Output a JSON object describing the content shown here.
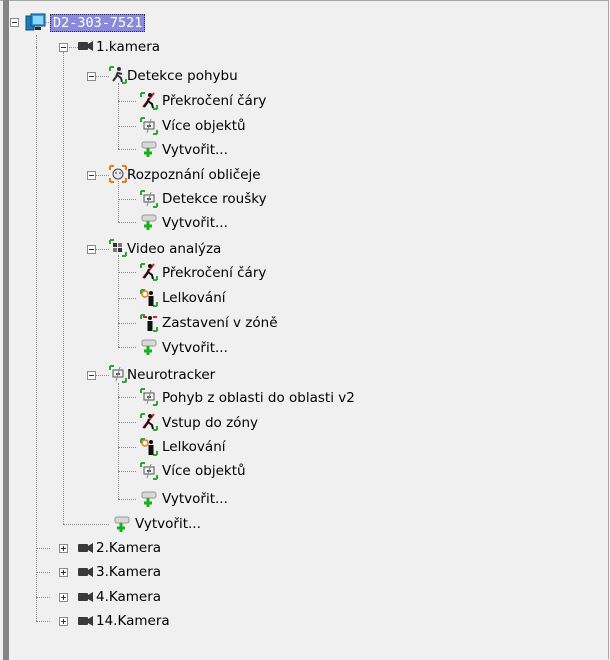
{
  "tree": {
    "server": "D2-303-7521",
    "camera1": {
      "label": "1.kamera",
      "detekce_pohybu": {
        "label": "Detekce pohybu",
        "children": [
          "Překročení čáry",
          "Více objektů",
          "Vytvořit..."
        ]
      },
      "rozpoznani": {
        "label": "Rozpoznání obličeje",
        "children": [
          "Detekce roušky",
          "Vytvořit..."
        ]
      },
      "video_analyza": {
        "label": "Video analýza",
        "children": [
          "Překročení čáry",
          "Lelkování",
          "Zastavení v zóně",
          "Vytvořit..."
        ]
      },
      "neurotracker": {
        "label": "Neurotracker",
        "children": [
          "Pohyb z oblasti do oblasti v2",
          "Vstup do zóny",
          "Lelkování",
          "Více objektů",
          "Vytvořit..."
        ]
      },
      "create": "Vytvořit..."
    },
    "cameras": [
      "2.Kamera",
      "3.Kamera",
      "4.Kamera",
      "14.Kamera"
    ]
  }
}
